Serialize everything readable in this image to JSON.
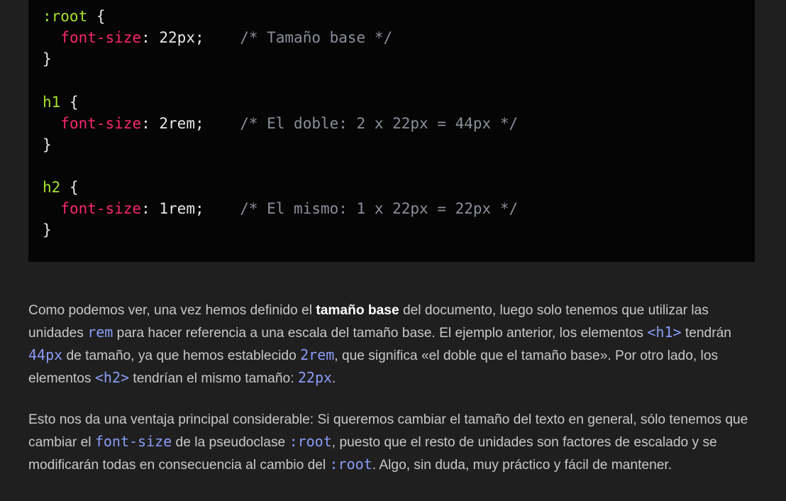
{
  "code": {
    "lines": [
      {
        "sel": ":root",
        "brace": " {"
      },
      {
        "indent": "  ",
        "prop": "font-size",
        "colon": ": ",
        "value": "22px;",
        "gap": "    ",
        "comment": "/* Tamaño base */"
      },
      {
        "brace": "}"
      },
      {},
      {
        "sel": "h1",
        "brace": " {"
      },
      {
        "indent": "  ",
        "prop": "font-size",
        "colon": ": ",
        "value": "2rem;",
        "gap": "    ",
        "comment": "/* El doble: 2 x 22px = 44px */"
      },
      {
        "brace": "}"
      },
      {},
      {
        "sel": "h2",
        "brace": " {"
      },
      {
        "indent": "  ",
        "prop": "font-size",
        "colon": ": ",
        "value": "1rem;",
        "gap": "    ",
        "comment": "/* El mismo: 1 x 22px = 22px */"
      },
      {
        "brace": "}"
      }
    ]
  },
  "paragraph1": {
    "t1": "Como podemos ver, una vez hemos definido el ",
    "strong1": "tamaño base",
    "t2": " del documento, luego solo tenemos que utilizar las unidades ",
    "code1": "rem",
    "t3": " para hacer referencia a una escala del tamaño base. El ejemplo anterior, los elementos ",
    "code2": "<h1>",
    "t4": " tendrán ",
    "code3": "44px",
    "t5": " de tamaño, ya que hemos establecido ",
    "code4": "2rem",
    "t6": ", que significa «el doble que el tamaño base». Por otro lado, los elementos ",
    "code5": "<h2>",
    "t7": " tendrían el mismo tamaño: ",
    "code6": "22px",
    "t8": "."
  },
  "paragraph2": {
    "t1": "Esto nos da una ventaja principal considerable: Si queremos cambiar el tamaño del texto en general, sólo tenemos que cambiar el ",
    "code1": "font-size",
    "t2": " de la pseudoclase ",
    "code2": ":root",
    "t3": ", puesto que el resto de unidades son factores de escalado y se modificarán todas en consecuencia al cambio del ",
    "code3": ":root",
    "t4": ". Algo, sin duda, muy práctico y fácil de mantener."
  }
}
